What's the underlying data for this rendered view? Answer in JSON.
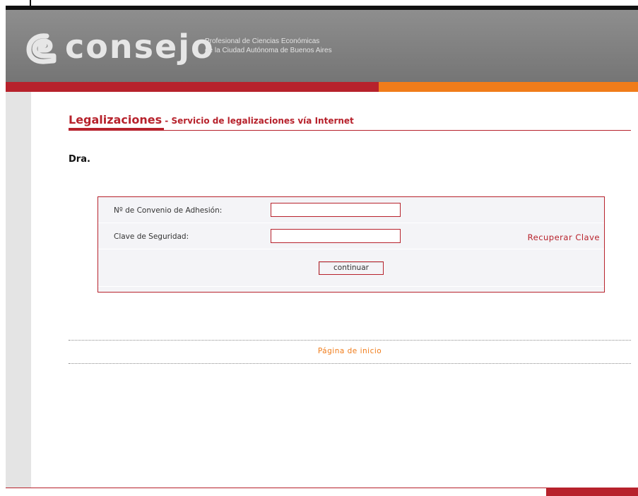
{
  "header": {
    "brand": "consejo",
    "tagline_line1": "Profesional de Ciencias Económicas",
    "tagline_line2": "de la Ciudad Autónoma de Buenos Aires"
  },
  "page": {
    "title": "Legalizaciones",
    "title_separator": " - ",
    "subtitle": "Servicio de legalizaciones vía Internet",
    "greeting": "Dra."
  },
  "form": {
    "convenio_label": "Nº de Convenio de Adhesión:",
    "convenio_value": "",
    "clave_label": "Clave de Seguridad:",
    "clave_value": "",
    "recover_link": "Recuperar Clave",
    "submit_label": "continuar"
  },
  "footer": {
    "home_link": "Página de inicio"
  },
  "colors": {
    "brand_red": "#b7222c",
    "brand_orange": "#f07c1a",
    "header_gray": "#7f7f7f"
  },
  "icons": {
    "logo": "consejo-logo-icon"
  }
}
